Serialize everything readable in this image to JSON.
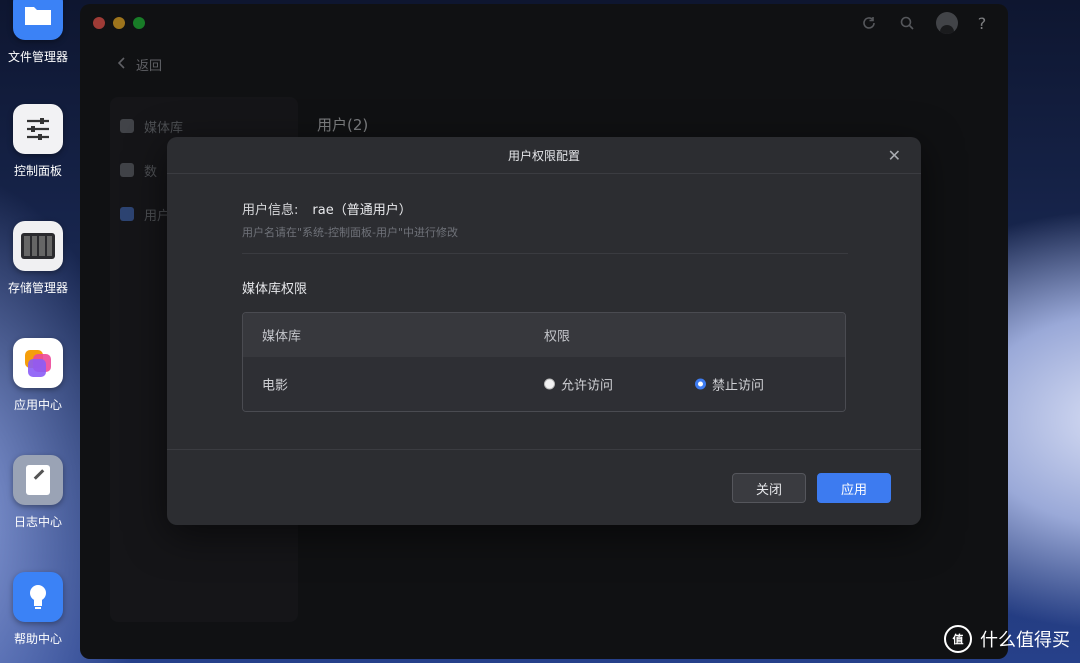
{
  "dock": {
    "items": [
      {
        "label": "文件管理器",
        "icon": "folder-icon"
      },
      {
        "label": "控制面板",
        "icon": "sliders-icon"
      },
      {
        "label": "存储管理器",
        "icon": "disk-array-icon"
      },
      {
        "label": "应用中心",
        "icon": "app-stack-icon"
      },
      {
        "label": "日志中心",
        "icon": "notebook-icon"
      },
      {
        "label": "帮助中心",
        "icon": "lightbulb-icon"
      }
    ]
  },
  "window": {
    "back_label": "返回",
    "sidebar": [
      {
        "label": "媒体库",
        "icon": "media-library-icon"
      },
      {
        "label": "数",
        "icon": "data-icon"
      },
      {
        "label": "用户",
        "icon": "user-icon"
      }
    ],
    "main_title": "用户(2)",
    "titlebar_icons": [
      "refresh-icon",
      "search-icon",
      "avatar",
      "help-icon"
    ],
    "help_glyph": "?"
  },
  "dialog": {
    "title": "用户权限配置",
    "close_glyph": "✕",
    "user_info_label": "用户信息:",
    "user_info_value": "rae（普通用户）",
    "user_hint": "用户名请在\"系统-控制面板-用户\"中进行修改",
    "section_title": "媒体库权限",
    "table": {
      "headers": [
        "媒体库",
        "权限"
      ],
      "rows": [
        {
          "library": "电影",
          "options": [
            "允许访问",
            "禁止访问"
          ],
          "selected": "禁止访问"
        }
      ]
    },
    "buttons": {
      "close": "关闭",
      "apply": "应用"
    }
  },
  "watermark": {
    "logo_text": "值",
    "text": "什么值得买"
  },
  "colors": {
    "accent": "#3d7bf0",
    "window_bg": "#1b1c1f",
    "dialog_bg": "#2c2d31"
  }
}
